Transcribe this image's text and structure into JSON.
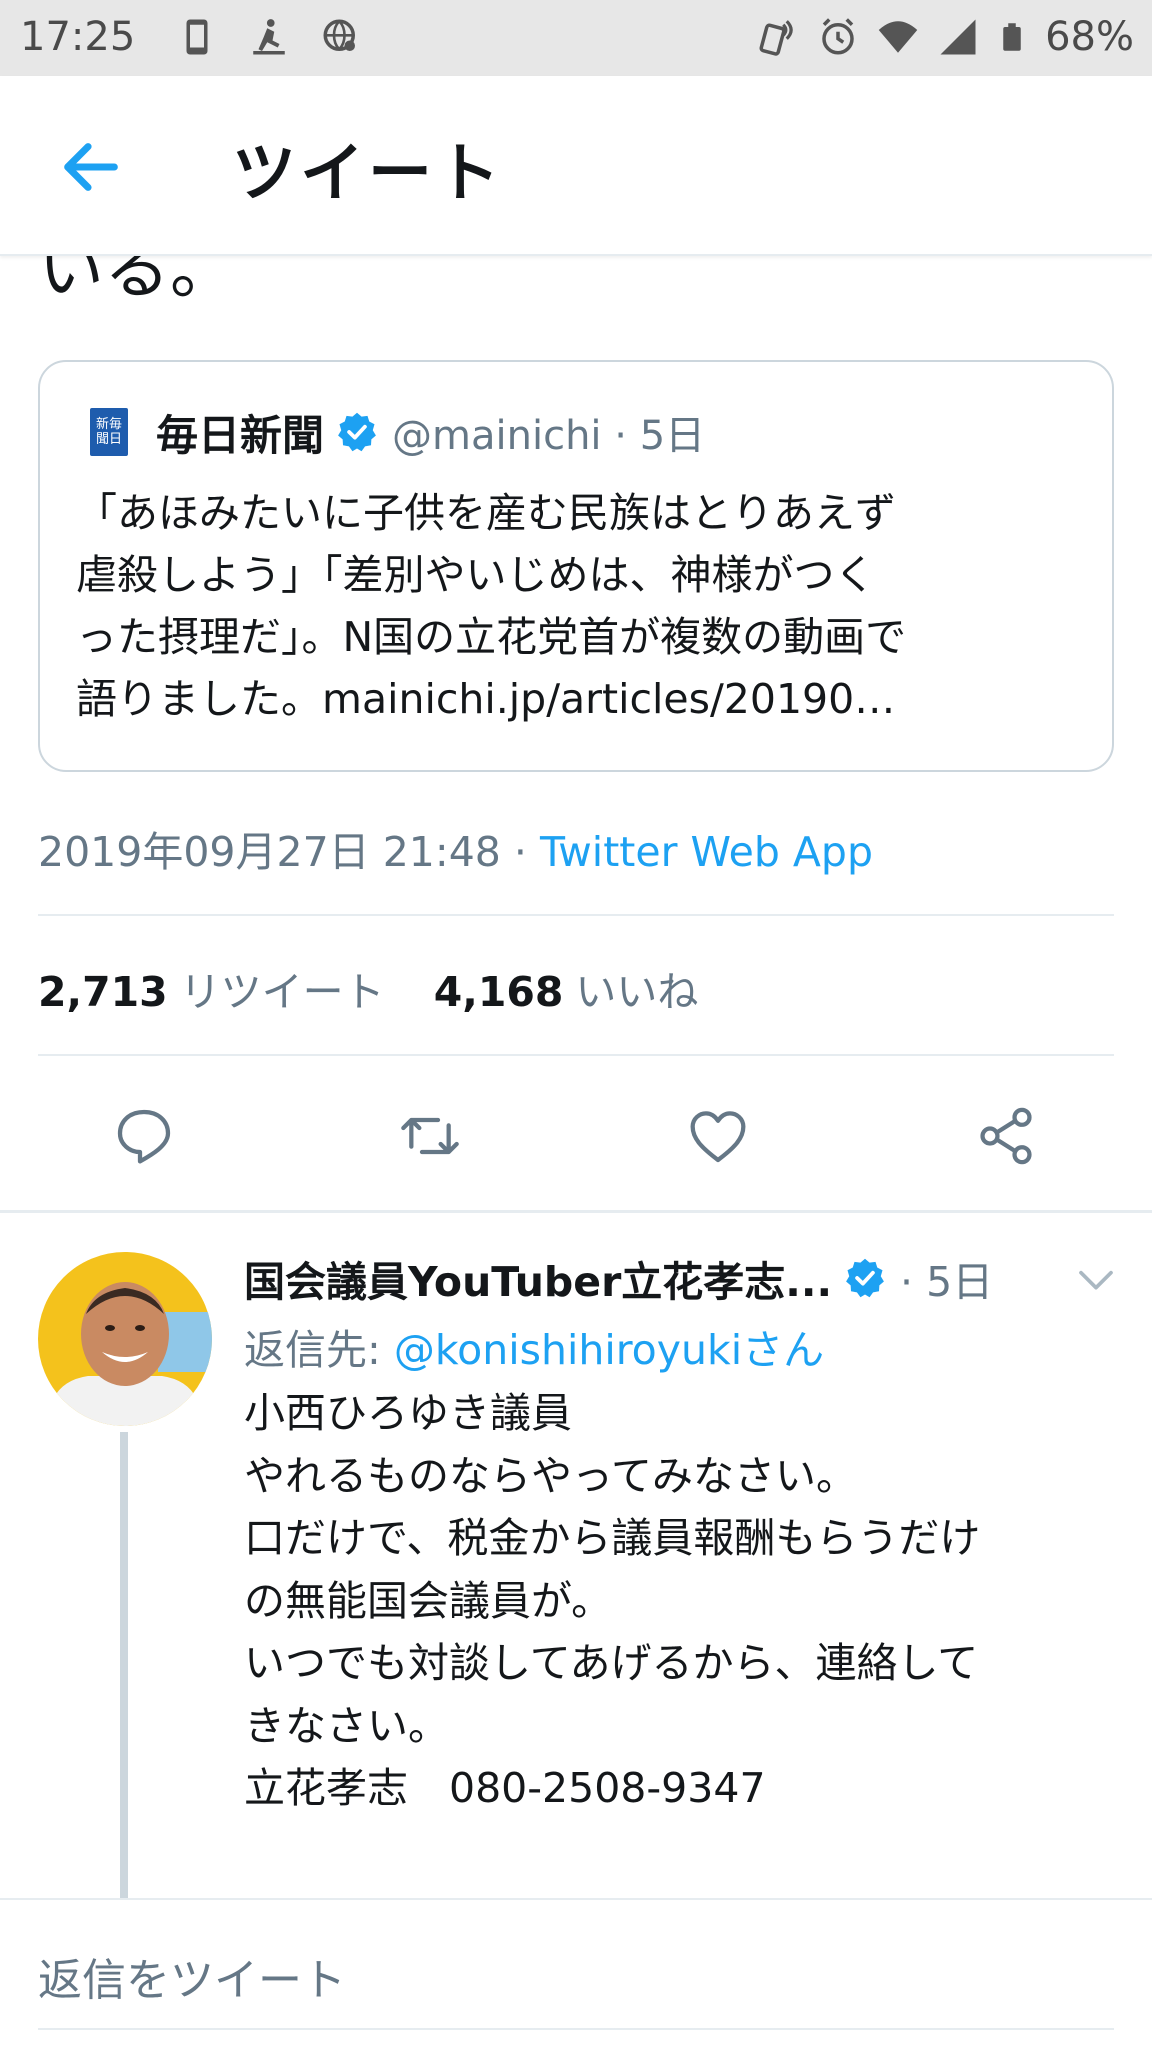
{
  "status_bar": {
    "time": "17:25",
    "battery": "68%",
    "left_icons": [
      "phone-icon",
      "person-icon",
      "globe-icon"
    ],
    "right_icons": [
      "nfc-icon",
      "alarm-icon",
      "wifi-icon",
      "signal-icon",
      "battery-icon"
    ]
  },
  "header": {
    "title": "ツイート",
    "back_icon": "arrow-left-icon"
  },
  "tweet": {
    "text_tail": "いる。",
    "quote": {
      "avatar_text": "新毎聞日",
      "name": "毎日新聞",
      "handle": "@mainichi",
      "separator": "·",
      "time": "5日",
      "lines": [
        "「あほみたいに子供を産む民族はとりあえず",
        "虐殺しよう」「差別やいじめは、神様がつく",
        "った摂理だ」。N国の立花党首が複数の動画で",
        "語りました。mainichi.jp/articles/20190…"
      ]
    },
    "timestamp": "2019年09月27日 21:48",
    "separator": "·",
    "source": "Twitter Web App",
    "retweets_count": "2,713",
    "retweets_label": "リツイート",
    "likes_count": "4,168",
    "likes_label": "いいね",
    "actions": [
      "reply-icon",
      "retweet-icon",
      "like-icon",
      "share-icon"
    ]
  },
  "reply": {
    "name": "国会議員YouTuber立花孝志...",
    "separator": "·",
    "time": "5日",
    "reply_to_prefix": "返信先:",
    "reply_to_handle": "@konishihiroyukiさん",
    "lines": [
      "小西ひろゆき議員",
      "やれるものならやってみなさい。",
      "口だけで、税金から議員報酬もらうだけ",
      "の無能国会議員が。",
      "いつでも対談してあげるから、連絡して",
      "きなさい。",
      "立花孝志　080-2508-9347"
    ]
  },
  "compose": {
    "placeholder": "返信をツイート"
  },
  "colors": {
    "accent": "#1da1f2",
    "text": "#14171a",
    "secondary": "#657786",
    "border": "#e6ecf0"
  }
}
